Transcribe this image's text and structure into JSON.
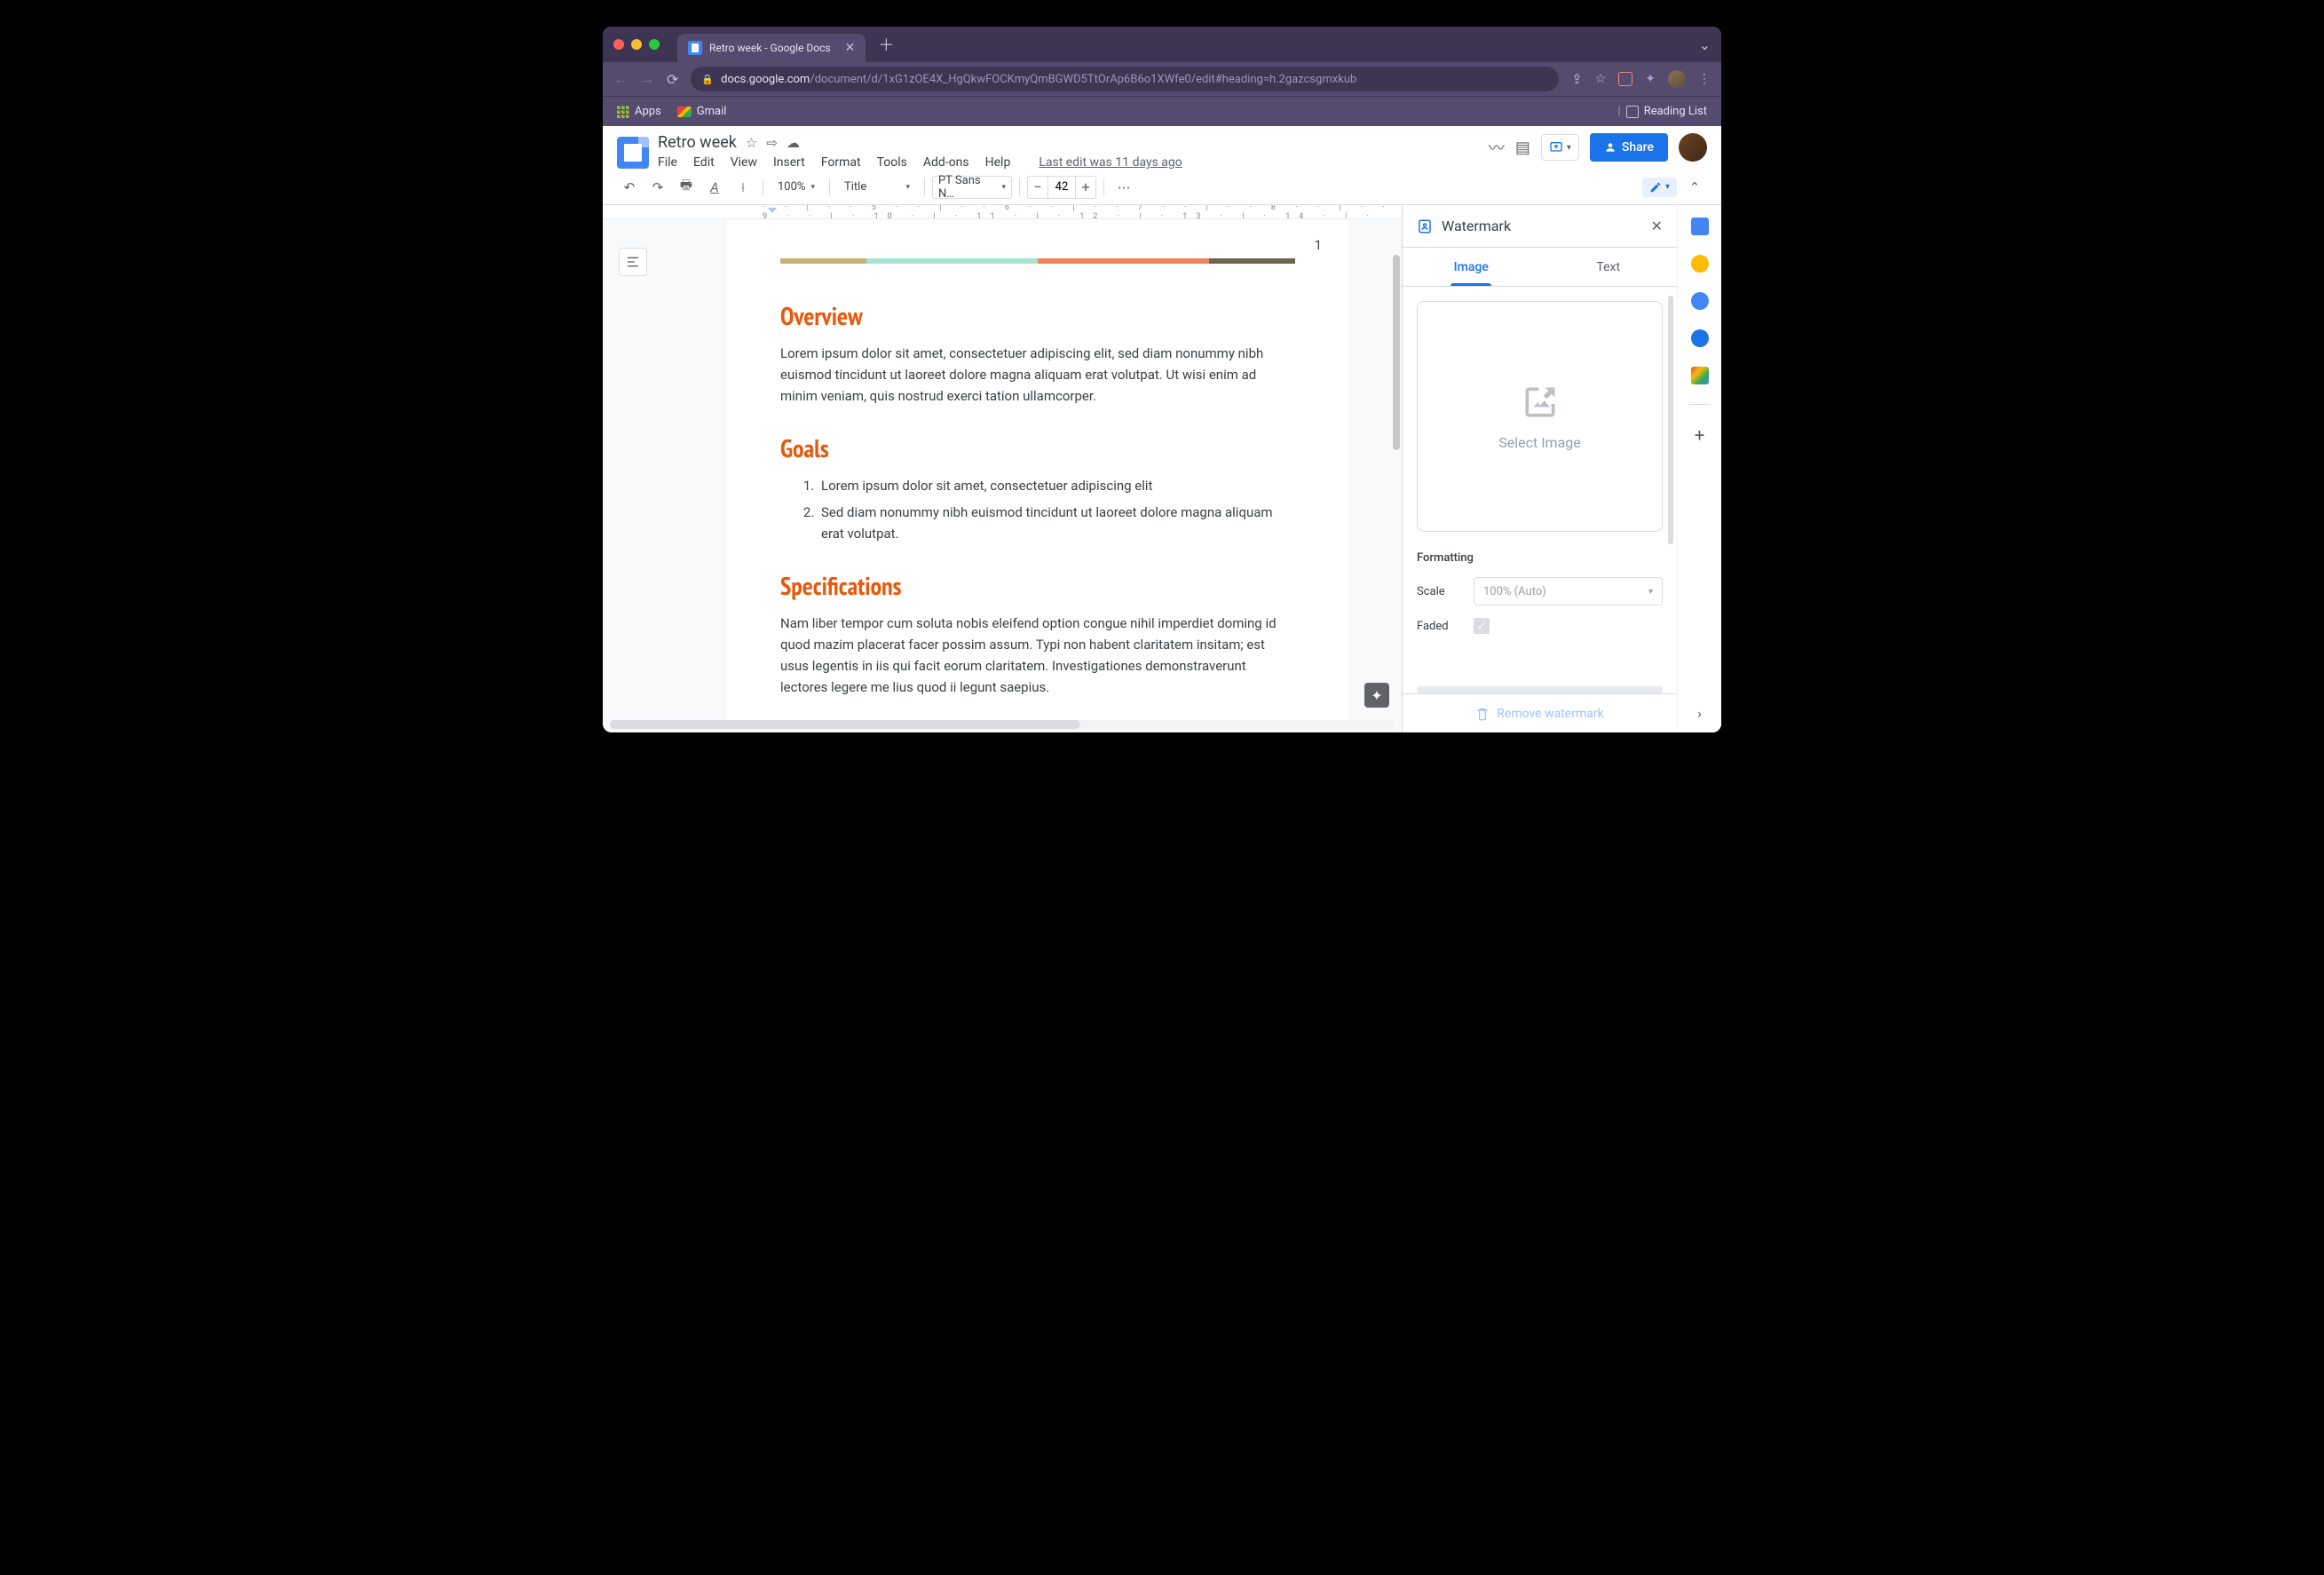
{
  "browser": {
    "tab_title": "Retro week - Google Docs",
    "url_host": "docs.google.com",
    "url_path": "/document/d/1xG1zOE4X_HgQkwFOCKmyQmBGWD5TtOrAp6B6o1XWfe0/edit#heading=h.2gazcsgmxkub",
    "bookmarks": {
      "apps": "Apps",
      "gmail": "Gmail",
      "reading_list": "Reading List"
    }
  },
  "docs": {
    "title": "Retro week",
    "menus": [
      "File",
      "Edit",
      "View",
      "Insert",
      "Format",
      "Tools",
      "Add-ons",
      "Help"
    ],
    "last_edit": "Last edit was 11 days ago",
    "share": "Share",
    "toolbar": {
      "zoom": "100%",
      "style": "Title",
      "font": "PT Sans N…",
      "size": "42"
    }
  },
  "document": {
    "page_number": "1",
    "colorbar": [
      "#c9b078",
      "#a6e3d1",
      "#a6e3d1",
      "#f0835b",
      "#f0835b",
      "#6d6552"
    ],
    "sections": [
      {
        "heading": "Overview",
        "body": "Lorem ipsum dolor sit amet, consectetuer adipiscing elit, sed diam nonummy nibh euismod tincidunt ut laoreet dolore magna aliquam erat volutpat. Ut wisi enim ad minim veniam, quis nostrud exerci tation ullamcorper."
      },
      {
        "heading": "Goals",
        "list": [
          "Lorem ipsum dolor sit amet, consectetuer adipiscing elit",
          "Sed diam nonummy nibh euismod tincidunt ut laoreet dolore magna aliquam erat volutpat."
        ]
      },
      {
        "heading": "Specifications",
        "body": "Nam liber tempor cum soluta nobis eleifend option congue nihil imperdiet doming id quod mazim placerat facer possim assum. Typi non habent claritatem insitam; est usus legentis in iis qui facit eorum claritatem. Investigationes demonstraverunt lectores legere me lius quod ii legunt saepius."
      }
    ]
  },
  "sidebar": {
    "title": "Watermark",
    "tabs": {
      "image": "Image",
      "text": "Text"
    },
    "select_image": "Select Image",
    "formatting": "Formatting",
    "scale_label": "Scale",
    "scale_value": "100% (Auto)",
    "faded_label": "Faded",
    "remove": "Remove watermark"
  }
}
